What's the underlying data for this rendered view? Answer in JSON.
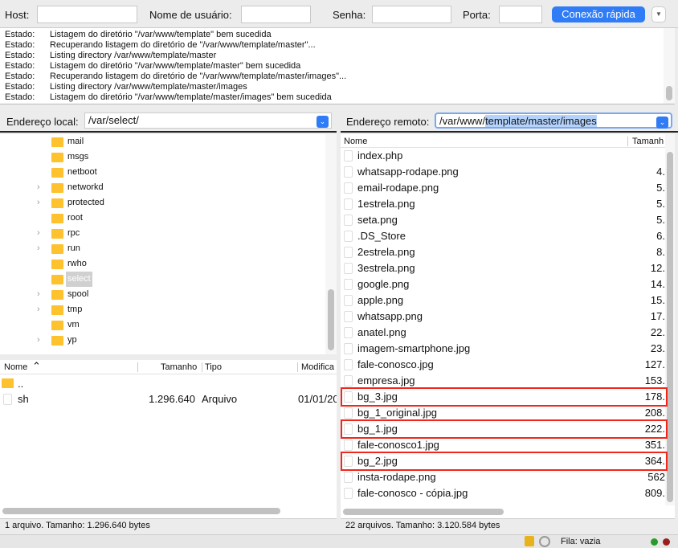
{
  "toolbar": {
    "host_label": "Host:",
    "user_label": "Nome de usuário:",
    "pass_label": "Senha:",
    "port_label": "Porta:",
    "host_value": "",
    "user_value": "",
    "pass_value": "",
    "port_value": "",
    "quickconnect_label": "Conexão rápida",
    "dropdown_icon": "triangle-down"
  },
  "log": [
    {
      "k": "Estado:",
      "v": "Listagem do diretório \"/var/www/template\" bem sucedida"
    },
    {
      "k": "Estado:",
      "v": "Recuperando listagem do diretório de \"/var/www/template/master\"..."
    },
    {
      "k": "Estado:",
      "v": "Listing directory /var/www/template/master"
    },
    {
      "k": "Estado:",
      "v": "Listagem do diretório \"/var/www/template/master\" bem sucedida"
    },
    {
      "k": "Estado:",
      "v": "Recuperando listagem do diretório de \"/var/www/template/master/images\"..."
    },
    {
      "k": "Estado:",
      "v": "Listing directory /var/www/template/master/images"
    },
    {
      "k": "Estado:",
      "v": "Listagem do diretório \"/var/www/template/master/images\" bem sucedida"
    }
  ],
  "local": {
    "address_label": "Endereço local:",
    "address_value": "/var/select/",
    "tree": [
      {
        "name": "mail",
        "expandable": false
      },
      {
        "name": "msgs",
        "expandable": false
      },
      {
        "name": "netboot",
        "expandable": false
      },
      {
        "name": "networkd",
        "expandable": true
      },
      {
        "name": "protected",
        "expandable": true
      },
      {
        "name": "root",
        "expandable": false
      },
      {
        "name": "rpc",
        "expandable": true
      },
      {
        "name": "run",
        "expandable": true
      },
      {
        "name": "rwho",
        "expandable": false
      },
      {
        "name": "select",
        "expandable": false,
        "selected": true
      },
      {
        "name": "spool",
        "expandable": true
      },
      {
        "name": "tmp",
        "expandable": true
      },
      {
        "name": "vm",
        "expandable": false
      },
      {
        "name": "yp",
        "expandable": true
      }
    ],
    "columns": {
      "name": "Nome",
      "size": "Tamanho",
      "type": "Tipo",
      "modified": "Modifica"
    },
    "files": [
      {
        "name": "..",
        "size": "",
        "type": "",
        "modified": "",
        "folder": true
      },
      {
        "name": "sh",
        "size": "1.296.640",
        "type": "Arquivo",
        "modified": "01/01/20",
        "folder": false
      }
    ],
    "status": "1 arquivo. Tamanho: 1.296.640 bytes"
  },
  "remote": {
    "address_label": "Endereço remoto:",
    "address_prefix": "/var/www/",
    "address_selected": "template/master/images",
    "columns": {
      "name": "Nome",
      "size": "Tamanh"
    },
    "files": [
      {
        "name": "index.php",
        "size": ""
      },
      {
        "name": "whatsapp-rodape.png",
        "size": "4."
      },
      {
        "name": "email-rodape.png",
        "size": "5."
      },
      {
        "name": "1estrela.png",
        "size": "5."
      },
      {
        "name": "seta.png",
        "size": "5."
      },
      {
        "name": ".DS_Store",
        "size": "6."
      },
      {
        "name": "2estrela.png",
        "size": "8."
      },
      {
        "name": "3estrela.png",
        "size": "12."
      },
      {
        "name": "google.png",
        "size": "14."
      },
      {
        "name": "apple.png",
        "size": "15."
      },
      {
        "name": "whatsapp.png",
        "size": "17."
      },
      {
        "name": "anatel.png",
        "size": "22."
      },
      {
        "name": "imagem-smartphone.jpg",
        "size": "23."
      },
      {
        "name": "fale-conosco.jpg",
        "size": "127."
      },
      {
        "name": "empresa.jpg",
        "size": "153."
      },
      {
        "name": "bg_3.jpg",
        "size": "178.",
        "highlighted": true
      },
      {
        "name": "bg_1_original.jpg",
        "size": "208."
      },
      {
        "name": "bg_1.jpg",
        "size": "222.",
        "highlighted": true
      },
      {
        "name": "fale-conosco1.jpg",
        "size": "351."
      },
      {
        "name": "bg_2.jpg",
        "size": "364.",
        "highlighted": true
      },
      {
        "name": "insta-rodape.png",
        "size": "562"
      },
      {
        "name": "fale-conosco - cópia.jpg",
        "size": "809."
      }
    ],
    "status": "22 arquivos. Tamanho: 3.120.584 bytes"
  },
  "bottom": {
    "queue": "Fila: vazia"
  },
  "colors": {
    "accent": "#2f7cf6",
    "highlight": "#f0281c",
    "folder": "#fdc22d"
  }
}
